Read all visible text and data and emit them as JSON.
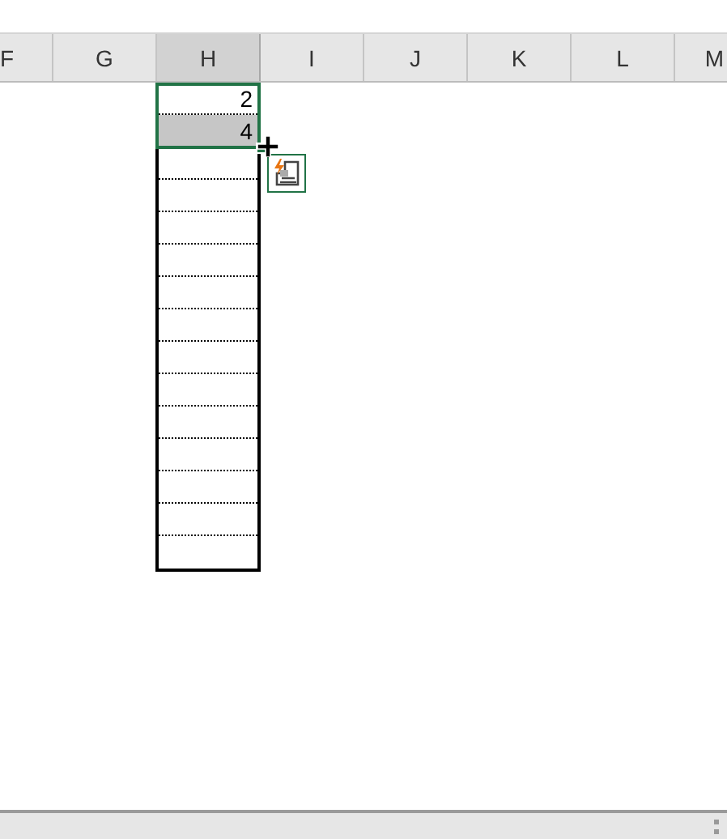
{
  "columns": [
    {
      "label": "F",
      "selected": false
    },
    {
      "label": "G",
      "selected": false
    },
    {
      "label": "H",
      "selected": true
    },
    {
      "label": "I",
      "selected": false
    },
    {
      "label": "J",
      "selected": false
    },
    {
      "label": "K",
      "selected": false
    },
    {
      "label": "L",
      "selected": false
    },
    {
      "label": "M",
      "selected": false
    }
  ],
  "cells": [
    {
      "value": "2",
      "selected": false
    },
    {
      "value": "4",
      "selected": true
    }
  ]
}
